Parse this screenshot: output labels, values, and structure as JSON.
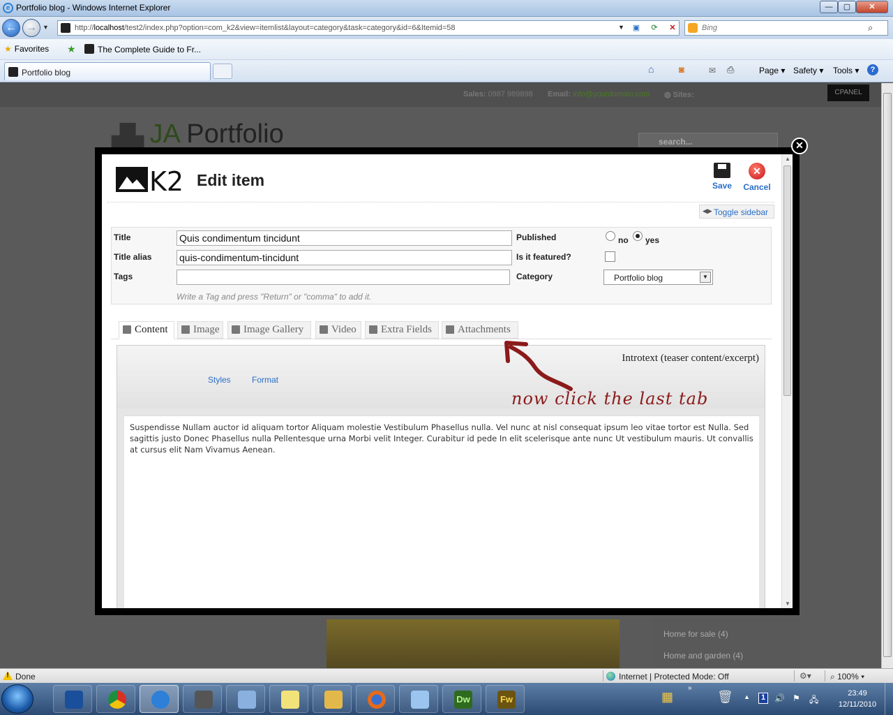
{
  "window": {
    "title": "Portfolio blog - Windows Internet Explorer",
    "minimize_label": "—",
    "maximize_label": "▢",
    "close_label": "✕"
  },
  "address": {
    "url_prefix": "http://",
    "url_host": "localhost",
    "url_rest": "/test2/index.php?option=com_k2&view=itemlist&layout=category&task=category&id=6&Itemid=58",
    "search_placeholder": "Bing"
  },
  "favorites": {
    "favorites_label": "Favorites",
    "link_label": "The Complete Guide to Fr..."
  },
  "tabs": {
    "active_tab": "Portfolio blog"
  },
  "commands": {
    "page": "Page ▾",
    "safety": "Safety ▾",
    "tools": "Tools ▾",
    "help": "?"
  },
  "site": {
    "sales_label": "Sales:",
    "sales_value": "0987 989898",
    "email_label": "Email:",
    "email_value": "info@yourdomain.com",
    "sites_label": "Sites:",
    "cpanel": "CPANEL",
    "logo_ja": "JA",
    "logo_text": "Portfolio",
    "search_placeholder": "search...",
    "sidebar_links": [
      "Home for sale (4)",
      "Home and garden (4)"
    ]
  },
  "k2": {
    "logo_text": "K2",
    "page_title": "Edit item",
    "save_label": "Save",
    "cancel_label": "Cancel",
    "toggle_sidebar": "Toggle sidebar",
    "fields": {
      "title_label": "Title",
      "title_value": "Quis condimentum tincidunt",
      "alias_label": "Title alias",
      "alias_value": "quis-condimentum-tincidunt",
      "tags_label": "Tags",
      "tags_value": "",
      "tags_hint": "Write a Tag and press \"Return\" or \"comma\" to add it.",
      "published_label": "Published",
      "published_no": "no",
      "published_yes": "yes",
      "published_selected": "yes",
      "featured_label": "Is it featured?",
      "featured_checked": false,
      "category_label": "Category",
      "category_value": "Portfolio blog"
    },
    "tabs": [
      "Content",
      "Image",
      "Image Gallery",
      "Video",
      "Extra Fields",
      "Attachments"
    ],
    "active_tab": "Content",
    "editor": {
      "introtext_label": "Introtext (teaser content/excerpt)",
      "styles_label": "Styles",
      "format_label": "Format",
      "body": "Suspendisse Nullam auctor id aliquam tortor Aliquam molestie Vestibulum Phasellus nulla. Vel nunc at nisl consequat ipsum leo vitae tortor est Nulla. Sed sagittis justo Donec Phasellus nulla Pellentesque urna Morbi velit Integer. Curabitur id pede In elit scelerisque ante nunc Ut vestibulum mauris. Ut convallis at cursus elit Nam Vivamus Aenean."
    }
  },
  "annotation": {
    "text": "now click the last tab",
    "color": "#8b1a1a"
  },
  "status": {
    "text": "Done",
    "zone": "Internet | Protected Mode: Off",
    "zoom": "100%"
  },
  "taskbar": {
    "dw_label": "Dw",
    "fw_label": "Fw",
    "time": "23:49",
    "date": "12/11/2010",
    "lang": "1"
  },
  "colors": {
    "link_blue": "#2a6ec7",
    "modal_border": "#000000",
    "ie_chrome": "#c9dbee"
  }
}
